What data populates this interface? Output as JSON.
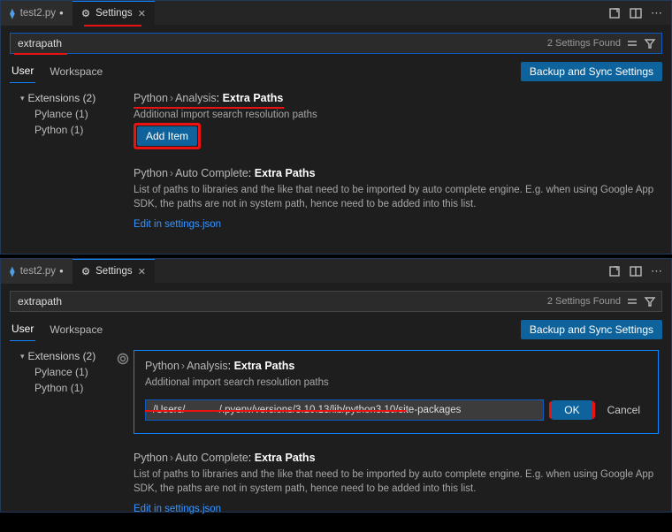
{
  "tabs": {
    "file": "test2.py",
    "settings": "Settings"
  },
  "search": {
    "value": "extrapath",
    "found": "2 Settings Found"
  },
  "scope": {
    "user": "User",
    "workspace": "Workspace"
  },
  "backup": "Backup and Sync Settings",
  "sidebar": {
    "ext_label": "Extensions (2)",
    "pylance": "Pylance (1)",
    "python": "Python (1)"
  },
  "setting1": {
    "crumb1": "Python",
    "crumb2": "Analysis",
    "name": "Extra Paths",
    "desc": "Additional import search resolution paths",
    "add": "Add Item",
    "path_value": "/Users/            /.pyenv/versions/3.10.13/lib/python3.10/site-packages",
    "ok": "OK",
    "cancel": "Cancel"
  },
  "setting2": {
    "crumb1": "Python",
    "crumb2": "Auto Complete",
    "name": "Extra Paths",
    "desc": "List of paths to libraries and the like that need to be imported by auto complete engine. E.g. when using Google App SDK, the paths are not in system path, hence need to be added into this list.",
    "edit": "Edit in settings.json"
  }
}
